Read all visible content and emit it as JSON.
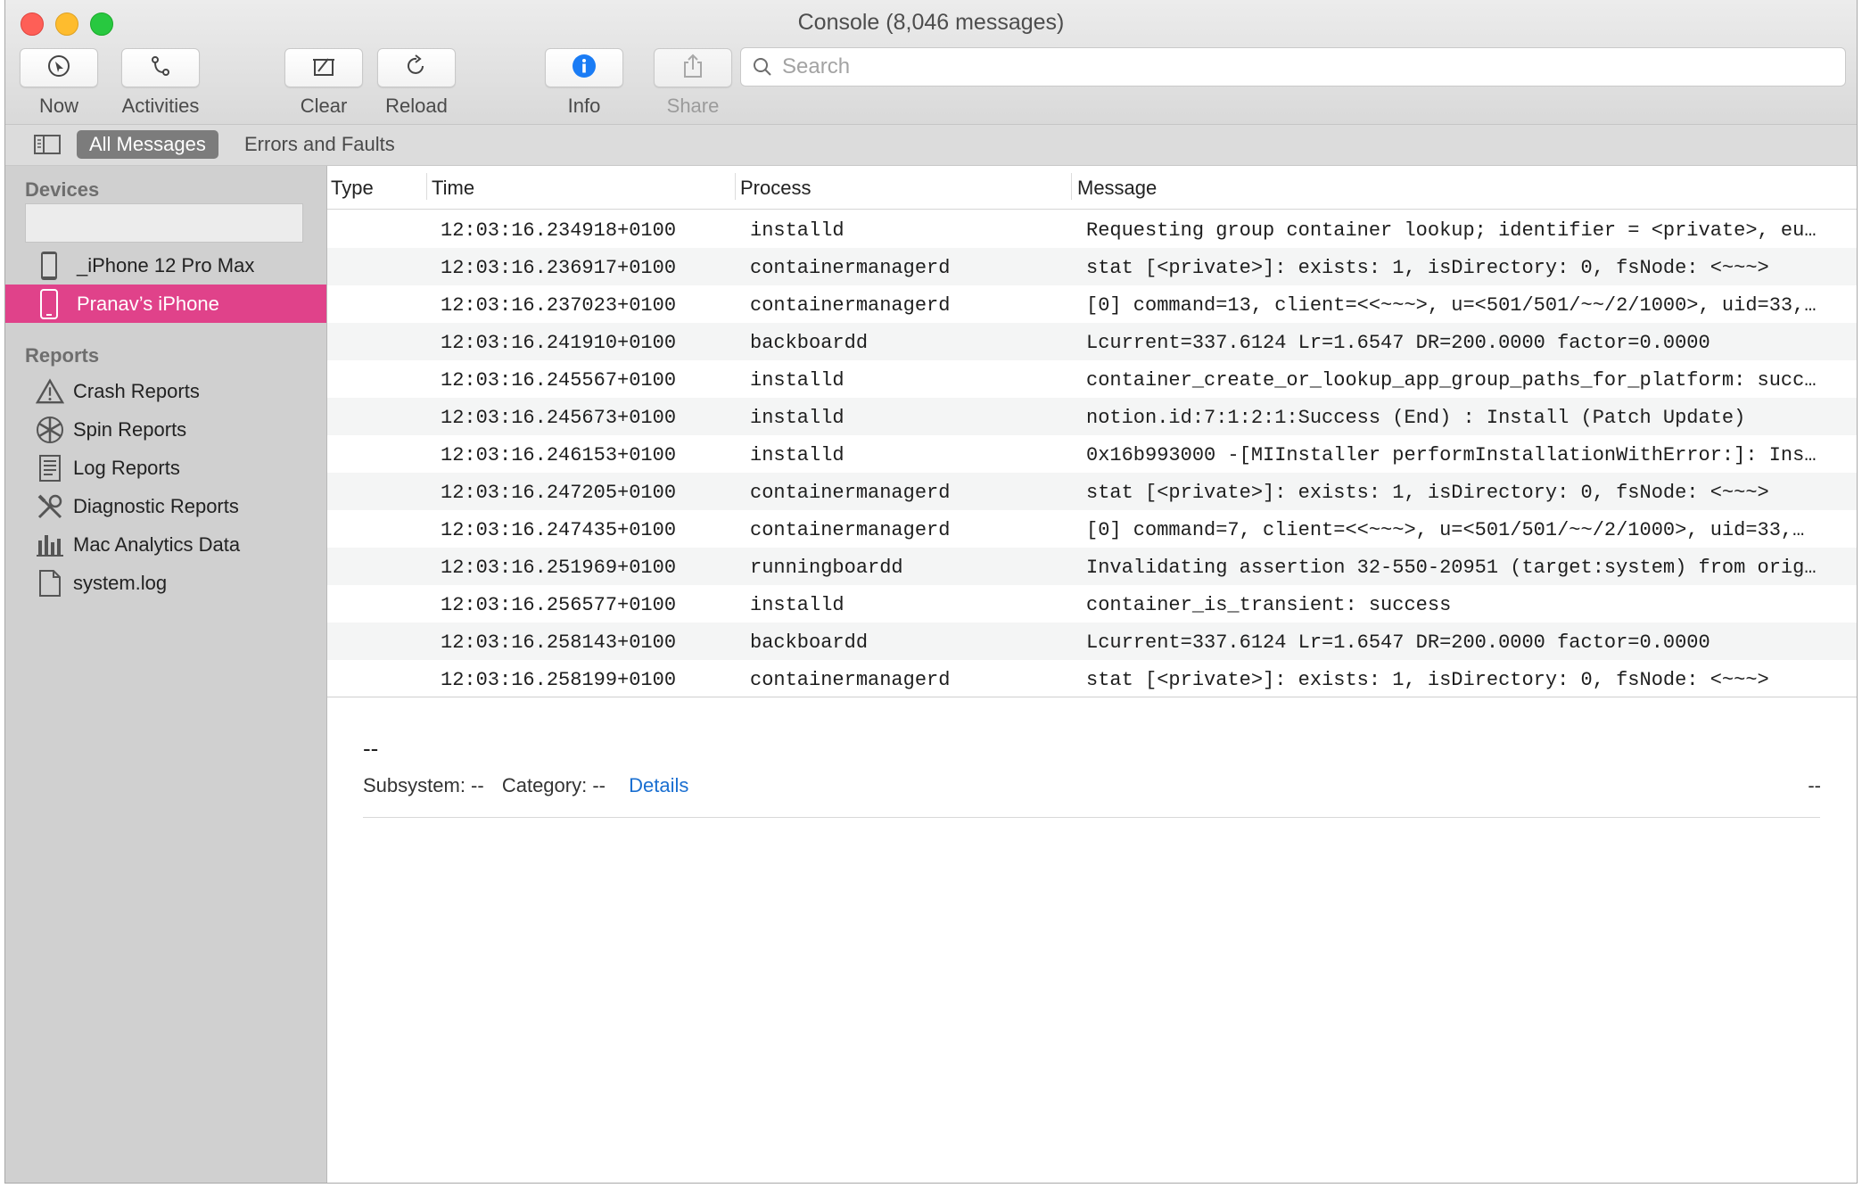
{
  "window": {
    "title": "Console (8,046 messages)"
  },
  "toolbar": {
    "now_label": "Now",
    "activities_label": "Activities",
    "clear_label": "Clear",
    "reload_label": "Reload",
    "info_label": "Info",
    "share_label": "Share",
    "search_placeholder": "Search"
  },
  "filters": {
    "all_messages": "All Messages",
    "errors_and_faults": "Errors and Faults"
  },
  "sidebar": {
    "devices_heading": "Devices",
    "devices": [
      {
        "label": "_iPhone 12 Pro Max",
        "icon": "iphone-icon",
        "selected": false
      },
      {
        "label": "Pranav’s iPhone",
        "icon": "iphone-icon",
        "selected": true
      }
    ],
    "reports_heading": "Reports",
    "reports": [
      {
        "label": "Crash Reports",
        "icon": "warning-triangle-icon"
      },
      {
        "label": "Spin Reports",
        "icon": "spinner-icon"
      },
      {
        "label": "Log Reports",
        "icon": "log-document-icon"
      },
      {
        "label": "Diagnostic Reports",
        "icon": "tools-icon"
      },
      {
        "label": "Mac Analytics Data",
        "icon": "bar-chart-icon"
      },
      {
        "label": "system.log",
        "icon": "document-icon"
      }
    ]
  },
  "table": {
    "columns": [
      "Type",
      "Time",
      "Process",
      "Message"
    ],
    "rows": [
      {
        "type": "",
        "time": "12:03:16.234918+0100",
        "process": "installd",
        "message": "Requesting group container lookup; identifier = <private>, eu…"
      },
      {
        "type": "",
        "time": "12:03:16.236917+0100",
        "process": "containermanagerd",
        "message": "stat [<private>]: exists: 1, isDirectory: 0, fsNode: <~~~>"
      },
      {
        "type": "",
        "time": "12:03:16.237023+0100",
        "process": "containermanagerd",
        "message": "[0] command=13, client=<<~~~>, u=<501/501/~~/2/1000>, uid=33,…"
      },
      {
        "type": "",
        "time": "12:03:16.241910+0100",
        "process": "backboardd",
        "message": "Lcurrent=337.6124 Lr=1.6547 DR=200.0000 factor=0.0000"
      },
      {
        "type": "",
        "time": "12:03:16.245567+0100",
        "process": "installd",
        "message": "container_create_or_lookup_app_group_paths_for_platform: succ…"
      },
      {
        "type": "",
        "time": "12:03:16.245673+0100",
        "process": "installd",
        "message": "notion.id:7:1:2:1:Success (End) : Install (Patch Update)"
      },
      {
        "type": "",
        "time": "12:03:16.246153+0100",
        "process": "installd",
        "message": "0x16b993000 -[MIInstaller performInstallationWithError:]: Ins…"
      },
      {
        "type": "",
        "time": "12:03:16.247205+0100",
        "process": "containermanagerd",
        "message": "stat [<private>]: exists: 1, isDirectory: 0, fsNode: <~~~>"
      },
      {
        "type": "",
        "time": "12:03:16.247435+0100",
        "process": "containermanagerd",
        "message": "[0] command=7, client=<<~~~>, u=<501/501/~~/2/1000>, uid=33,…"
      },
      {
        "type": "",
        "time": "12:03:16.251969+0100",
        "process": "runningboardd",
        "message": "Invalidating assertion 32-550-20951 (target:system) from orig…"
      },
      {
        "type": "",
        "time": "12:03:16.256577+0100",
        "process": "installd",
        "message": "container_is_transient: success"
      },
      {
        "type": "",
        "time": "12:03:16.258143+0100",
        "process": "backboardd",
        "message": "Lcurrent=337.6124 Lr=1.6547 DR=200.0000 factor=0.0000"
      },
      {
        "type": "",
        "time": "12:03:16.258199+0100",
        "process": "containermanagerd",
        "message": "stat [<private>]: exists: 1, isDirectory: 0, fsNode: <~~~>"
      }
    ]
  },
  "detail": {
    "title": "--",
    "subsystem": "Subsystem: --",
    "category": "Category: --",
    "details_link": "Details",
    "right_value": "--"
  },
  "colors": {
    "selection": "#e0428a",
    "link": "#1a6fd1",
    "info_blue": "#1a7cf5"
  }
}
